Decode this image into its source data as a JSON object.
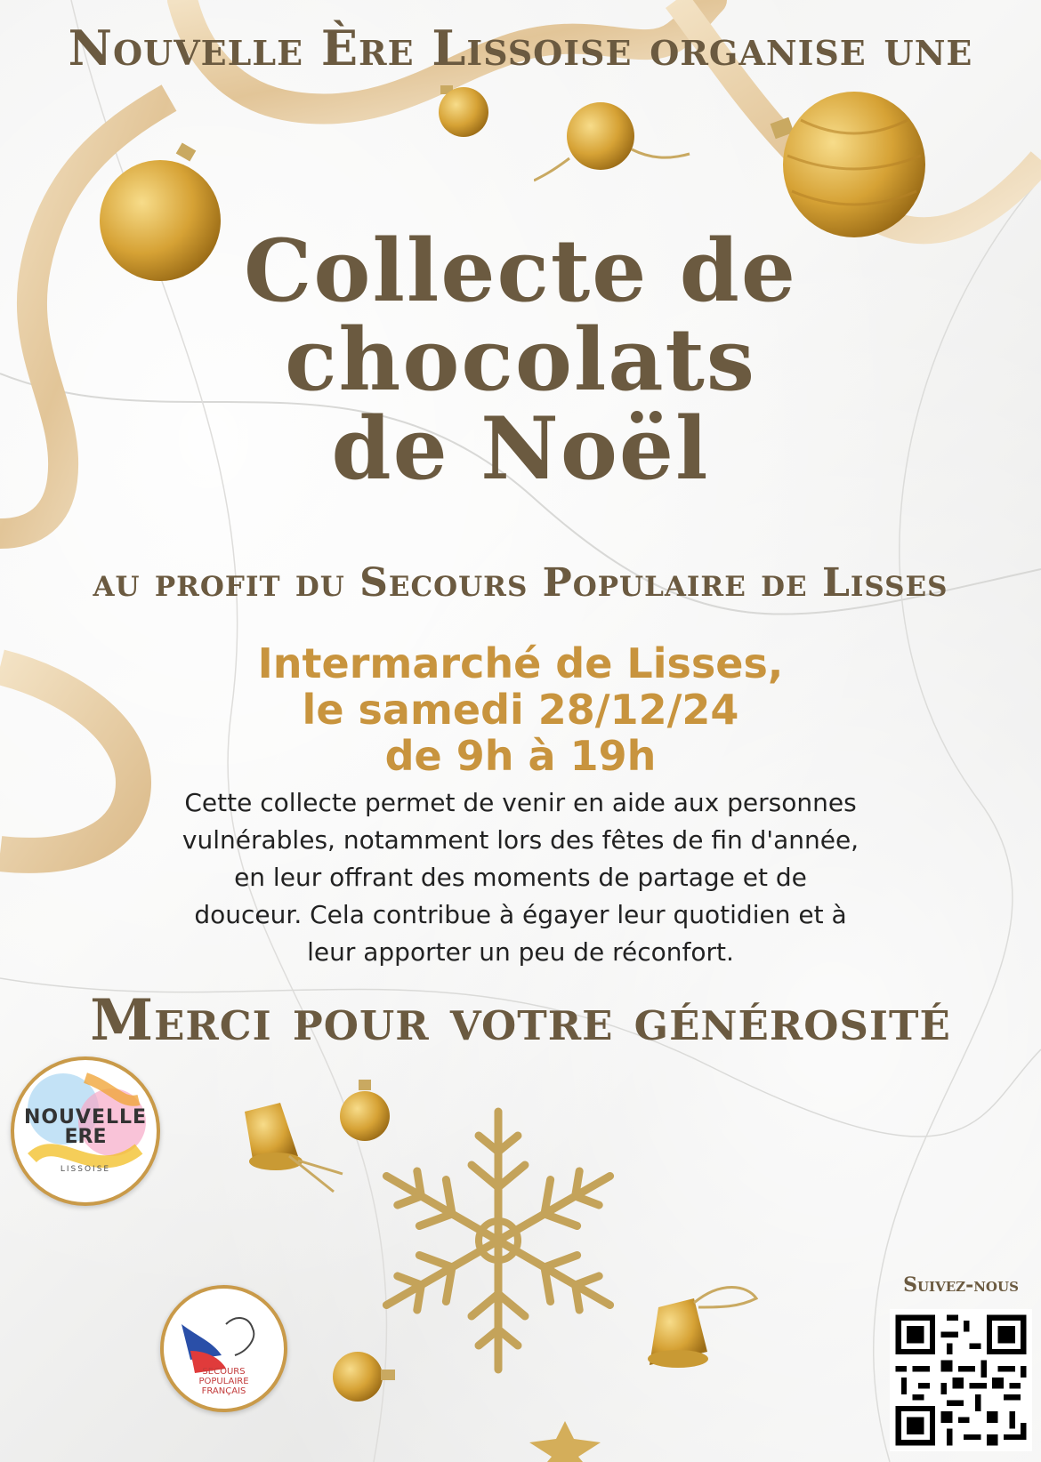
{
  "poster": {
    "organizer_line": "Nouvelle Ère Lissoise organise une",
    "title_lines": [
      "Collecte de",
      "chocolats",
      "de Noël"
    ],
    "beneficiary": "au profit du Secours Populaire de Lisses",
    "when_lines": [
      "Intermarché de Lisses,",
      "le samedi 28/12/24",
      "de 9h à 19h"
    ],
    "description_lines": [
      "Cette collecte permet de venir en aide aux personnes",
      "vulnérables, notamment lors des fêtes de fin d'année,",
      "en leur offrant des moments de partage et de",
      "douceur. Cela contribue à égayer leur quotidien et à",
      "leur apporter un peu de réconfort."
    ],
    "thanks": "Merci pour votre générosité",
    "follow_label": "Suivez-nous"
  },
  "logos": {
    "nouvelle_ere": {
      "line1": "NOUVELLE",
      "line2": "ERE",
      "line3": "LISSOISE"
    },
    "secours_populaire": {
      "lines": [
        "SECOURS",
        "POPULAIRE",
        "FRANÇAIS"
      ]
    }
  },
  "colors": {
    "heading": "#6b5a40",
    "accent_gold": "#c8943e",
    "body_text": "#222222",
    "ornament_gold": "#d4a73c"
  }
}
